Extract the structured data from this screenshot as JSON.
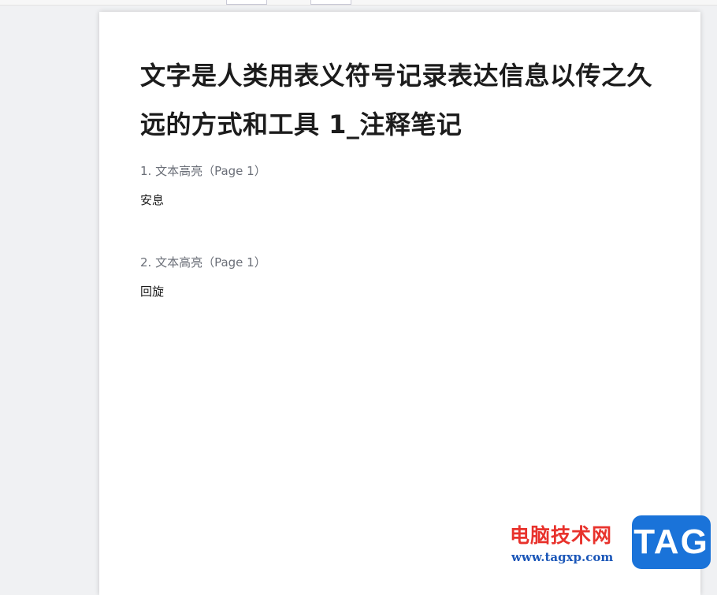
{
  "document": {
    "title": "文字是人类用表义符号记录表达信息以传之久远的方式和工具 1_注释笔记",
    "notes": [
      {
        "heading": "1. 文本高亮（Page 1）",
        "body": "安息"
      },
      {
        "heading": "2. 文本高亮（Page 1）",
        "body": "回旋"
      }
    ]
  },
  "watermark": {
    "site_name": "电脑技术网",
    "url": "www.tagxp.com",
    "badge": "TAG"
  },
  "colors": {
    "title": "#1c1c1c",
    "note_heading": "#6b6f78",
    "watermark_red": "#e8322c",
    "watermark_blue": "#1a73d9"
  }
}
